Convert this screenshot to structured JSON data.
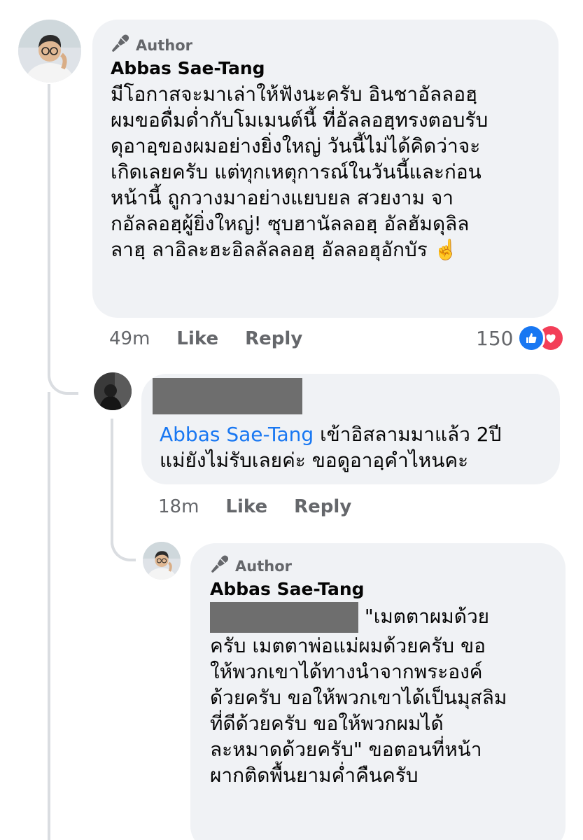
{
  "comment1": {
    "author_tag": "Author",
    "name": "Abbas Sae-Tang",
    "text": "มีโอกาสจะมาเล่าให้ฟังนะครับ อินชาอัลลอฮฺ\nผมขอดื่มด่ำกับโมเมนต์นี้ ที่อัลลอฮฺทรงตอบรับ\nดุอาอฺของผมอย่างยิ่งใหญ่ วันนี้ไม่ได้คิดว่าจะ\nเกิดเลยครับ แต่ทุกเหตุการณ์ในวันนี้และก่อน\nหน้านี้ ถูกวางมาอย่างแยบยล สวยงาม จา\nกอัลลอฮฺผู้ยิ่งใหญ่! ซุบฮานัลลอฮฺ อัลฮัมดุลิล\nลาฮฺ ลาอิละฮะอิลลัลลอฮฺ อัลลอฮุอักบัร ☝️",
    "time": "49m",
    "like_label": "Like",
    "reply_label": "Reply",
    "reaction_count": "150",
    "reactions": [
      "like-reaction-icon",
      "love-reaction-icon"
    ],
    "colors": {
      "like": "#1877f2",
      "love": "#f33e58"
    }
  },
  "reply1": {
    "mention": "Abbas Sae-Tang",
    "text_after_mention": " เข้าอิสลามมาแล้ว 2ปี\nแม่ยังไม่รับเลยค่ะ ขอดูอาอฺคำไหนคะ",
    "time": "18m",
    "like_label": "Like",
    "reply_label": "Reply"
  },
  "reply2": {
    "author_tag": "Author",
    "name": "Abbas Sae-Tang",
    "text_line1": " \"เมตตาผมด้วย",
    "text_rest": "ครับ เมตตาพ่อแม่ผมด้วยครับ ขอ\nให้พวกเขาได้ทางนำจากพระองค์\nด้วยครับ ขอให้พวกเขาได้เป็นมุสลิม\nที่ดีด้วยครับ ขอให้พวกผมได้\nละหมาดด้วยครับ\" ขอตอนที่หน้า\nผากติดพื้นยามค่ำคืนครับ"
  }
}
